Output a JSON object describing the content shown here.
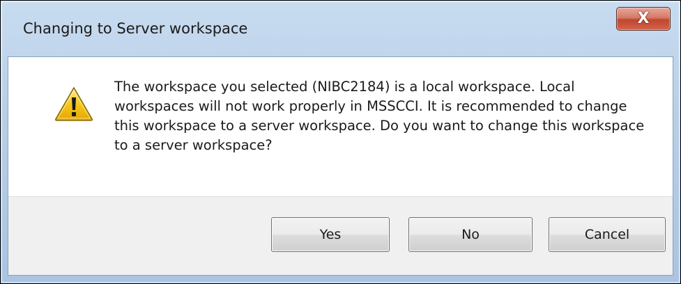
{
  "dialog": {
    "title": "Changing to Server workspace",
    "close_label": "X",
    "icon": "warning-triangle-icon",
    "message": "The workspace you selected (NIBC2184) is a local workspace. Local workspaces will not work properly in MSSCCI. It is recommended to change this workspace to a server workspace. Do you want to change this workspace to a server workspace?",
    "buttons": {
      "yes_label": "Yes",
      "no_label": "No",
      "cancel_label": "Cancel"
    }
  },
  "colors": {
    "titlebar": "#b9cfe8",
    "close_button": "#c0452e",
    "warning_fill": "#f5c518",
    "body_background": "#ffffff",
    "button_area": "#f0f0f0"
  }
}
